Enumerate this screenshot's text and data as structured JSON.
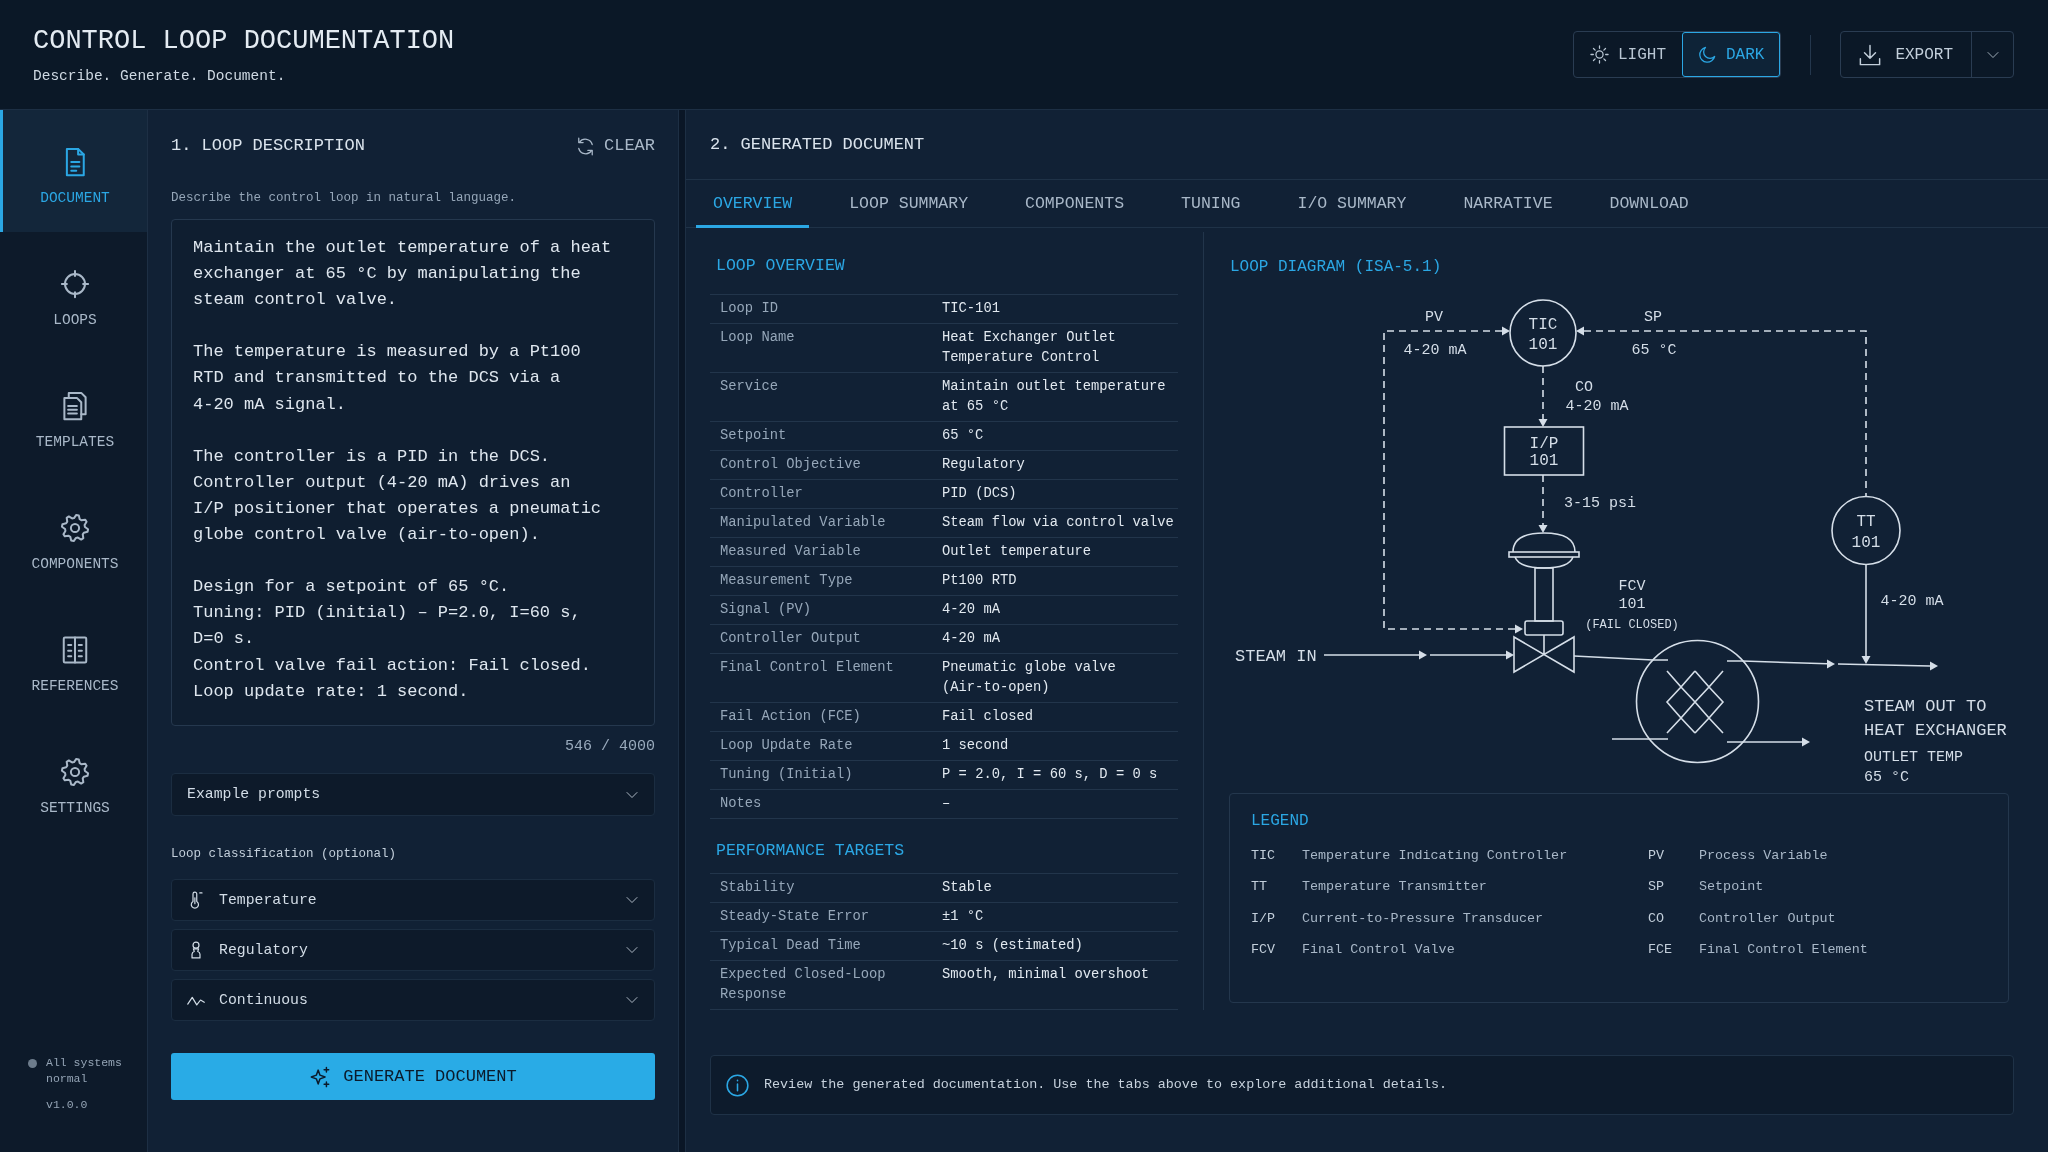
{
  "header": {
    "title": "CONTROL LOOP DOCUMENTATION",
    "subtitle": "Describe. Generate. Document.",
    "theme_options": [
      {
        "label": "LIGHT",
        "selected": false
      },
      {
        "label": "DARK",
        "selected": true
      }
    ],
    "export_button": "EXPORT"
  },
  "sidebar": {
    "items": [
      {
        "label": "DOCUMENT",
        "selected": true
      },
      {
        "label": "LOOPS",
        "selected": false
      },
      {
        "label": "TEMPLATES",
        "selected": false
      },
      {
        "label": "COMPONENTS",
        "selected": false
      },
      {
        "label": "REFERENCES",
        "selected": false
      },
      {
        "label": "SETTINGS",
        "selected": false
      }
    ],
    "status": "All systems normal",
    "version": "v1.0.0"
  },
  "loop_description": {
    "title": "1. LOOP DESCRIPTION",
    "clear_button": "CLEAR",
    "instructions": "Describe the control loop in natural language.",
    "value": "Maintain the outlet temperature of a heat\nexchanger at 65 °C by manipulating the\nsteam control valve.\n\nThe temperature is measured by a Pt100\nRTD and transmitted to the DCS via a\n4-20 mA signal.\n\nThe controller is a PID in the DCS.\nController output (4-20 mA) drives an\nI/P positioner that operates a pneumatic\nglobe control valve (air-to-open).\n\nDesign for a setpoint of 65 °C.\nTuning: PID (initial) – P=2.0, I=60 s,\nD=0 s.\nControl valve fail action: Fail closed.\nLoop update rate: 1 second.",
    "counter": "546 / 4000",
    "example_prompts": "Example prompts",
    "classification_label": "Loop classification (optional)",
    "classifications": [
      "Temperature",
      "Regulatory",
      "Continuous"
    ],
    "generate_button": "GENERATE DOCUMENT"
  },
  "generated_document": {
    "title": "2. GENERATED DOCUMENT",
    "tabs": [
      {
        "label": "OVERVIEW",
        "selected": true
      },
      {
        "label": "LOOP SUMMARY",
        "selected": false
      },
      {
        "label": "COMPONENTS",
        "selected": false
      },
      {
        "label": "TUNING",
        "selected": false
      },
      {
        "label": "I/O SUMMARY",
        "selected": false
      },
      {
        "label": "NARRATIVE",
        "selected": false
      },
      {
        "label": "DOWNLOAD",
        "selected": false
      }
    ],
    "sections": [
      {
        "title": "LOOP OVERVIEW",
        "rows": [
          {
            "label": "Loop ID",
            "value": "TIC-101"
          },
          {
            "label": "Loop Name",
            "value": "Heat Exchanger Outlet Temperature Control"
          },
          {
            "label": "Service",
            "value": "Maintain outlet temperature at 65 °C"
          },
          {
            "label": "Setpoint",
            "value": "65 °C"
          },
          {
            "label": "Control Objective",
            "value": "Regulatory"
          },
          {
            "label": "Controller",
            "value": "PID (DCS)"
          },
          {
            "label": "Manipulated Variable",
            "value": "Steam flow via control valve"
          },
          {
            "label": "Measured Variable",
            "value": "Outlet temperature"
          },
          {
            "label": "Measurement Type",
            "value": "Pt100 RTD"
          },
          {
            "label": "Signal (PV)",
            "value": "4-20 mA"
          },
          {
            "label": "Controller Output",
            "value": "4-20 mA"
          },
          {
            "label": "Final Control Element",
            "value": "Pneumatic globe valve (Air-to-open)"
          },
          {
            "label": "Fail Action (FCE)",
            "value": "Fail closed"
          },
          {
            "label": "Loop Update Rate",
            "value": "1 second"
          },
          {
            "label": "Tuning (Initial)",
            "value": "P = 2.0, I = 60 s, D = 0 s"
          },
          {
            "label": "Notes",
            "value": "–"
          }
        ]
      },
      {
        "title": "PERFORMANCE TARGETS",
        "rows": [
          {
            "label": "Stability",
            "value": "Stable"
          },
          {
            "label": "Steady-State Error",
            "value": "±1 °C"
          },
          {
            "label": "Typical Dead Time",
            "value": "~10 s (estimated)"
          },
          {
            "label": "Expected Closed-Loop Response",
            "value": "Smooth, minimal overshoot"
          }
        ]
      }
    ],
    "diagram": {
      "title": "LOOP DIAGRAM (ISA-5.1)",
      "controller": {
        "tag": "TIC",
        "number": "101"
      },
      "transducer": {
        "tag": "I/P",
        "number": "101"
      },
      "transmitter": {
        "tag": "TT",
        "number": "101"
      },
      "valve": {
        "tag": "FCV",
        "number": "101",
        "fail_action": "(FAIL CLOSED)"
      },
      "signals": {
        "pv": {
          "name": "PV",
          "value": "4-20 mA"
        },
        "sp": {
          "name": "SP",
          "value": "65 °C"
        },
        "co": {
          "name": "CO",
          "value": "4-20 mA"
        },
        "pneumatic": "3-15 psi",
        "transmitter_output": "4-20 mA"
      },
      "process": {
        "inlet": "STEAM IN",
        "outlet": [
          "STEAM OUT TO",
          "HEAT EXCHANGER"
        ],
        "measurement": [
          "OUTLET TEMP",
          "65 °C"
        ]
      }
    },
    "legend": {
      "title": "LEGEND",
      "columns": [
        [
          {
            "abbr": "TIC",
            "meaning": "Temperature Indicating Controller"
          },
          {
            "abbr": "TT",
            "meaning": "Temperature Transmitter"
          },
          {
            "abbr": "I/P",
            "meaning": "Current-to-Pressure Transducer"
          },
          {
            "abbr": "FCV",
            "meaning": "Final Control Valve"
          }
        ],
        [
          {
            "abbr": "PV",
            "meaning": "Process Variable"
          },
          {
            "abbr": "SP",
            "meaning": "Setpoint"
          },
          {
            "abbr": "CO",
            "meaning": "Controller Output"
          },
          {
            "abbr": "FCE",
            "meaning": "Final Control Element"
          }
        ]
      ]
    },
    "info": "Review the generated documentation. Use the tabs above to explore additional details."
  }
}
